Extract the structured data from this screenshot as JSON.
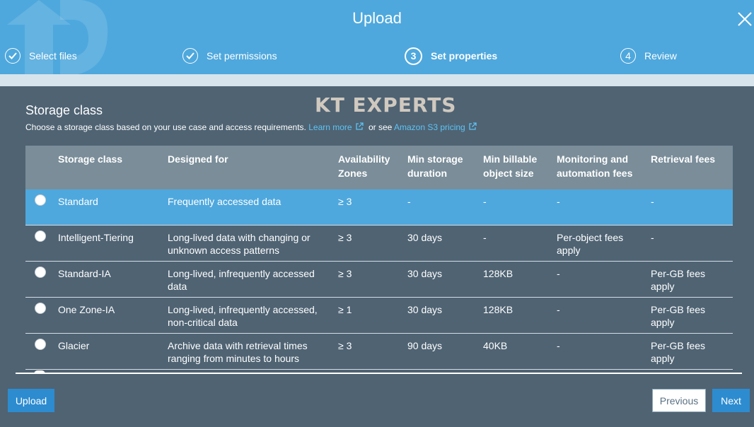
{
  "dialog": {
    "title": "Upload"
  },
  "steps": [
    {
      "label": "Select files",
      "state": "done"
    },
    {
      "label": "Set permissions",
      "state": "done"
    },
    {
      "label": "Set properties",
      "number": "3",
      "state": "active"
    },
    {
      "label": "Review",
      "number": "4",
      "state": "pending"
    }
  ],
  "watermark": "KT EXPERTS",
  "storage": {
    "title": "Storage class",
    "description": "Choose a storage class based on your use case and access requirements.",
    "learn_more": "Learn more",
    "or_see": "or see",
    "pricing_link": "Amazon S3 pricing"
  },
  "table": {
    "headers": {
      "name": "Storage class",
      "designed": "Designed for",
      "az_line1": "Availability",
      "az_line2": "Zones",
      "dur_line1": "Min storage",
      "dur_line2": "duration",
      "size_line1": "Min billable",
      "size_line2": "object size",
      "mon_line1": "Monitoring and",
      "mon_line2": "automation fees",
      "retrieval": "Retrieval fees"
    },
    "rows": [
      {
        "name": "Standard",
        "designed": "Frequently accessed data",
        "az": "≥ 3",
        "duration": "-",
        "size": "-",
        "monitoring": "-",
        "retrieval": "-",
        "selected": true
      },
      {
        "name": "Intelligent-Tiering",
        "designed": "Long-lived data with changing or unknown access patterns",
        "az": "≥ 3",
        "duration": "30 days",
        "size": "-",
        "monitoring": "Per-object fees apply",
        "retrieval": "-",
        "selected": false
      },
      {
        "name": "Standard-IA",
        "designed": "Long-lived, infrequently accessed data",
        "az": "≥ 3",
        "duration": "30 days",
        "size": "128KB",
        "monitoring": "-",
        "retrieval": "Per-GB fees apply",
        "selected": false
      },
      {
        "name": "One Zone-IA",
        "designed": "Long-lived, infrequently accessed, non-critical data",
        "az": "≥ 1",
        "duration": "30 days",
        "size": "128KB",
        "monitoring": "-",
        "retrieval": "Per-GB fees apply",
        "selected": false
      },
      {
        "name": "Glacier",
        "designed": "Archive data with retrieval times ranging from minutes to hours",
        "az": "≥ 3",
        "duration": "90 days",
        "size": "40KB",
        "monitoring": "-",
        "retrieval": "Per-GB fees apply",
        "selected": false
      }
    ]
  },
  "footer": {
    "upload": "Upload",
    "previous": "Previous",
    "next": "Next"
  },
  "colors": {
    "header": "#4ea8dd",
    "background": "#4f6373",
    "table_header": "#7a8d99",
    "selected_row": "#4ea8dd",
    "link": "#5ec3f3",
    "primary_button": "#2d8cd0"
  }
}
